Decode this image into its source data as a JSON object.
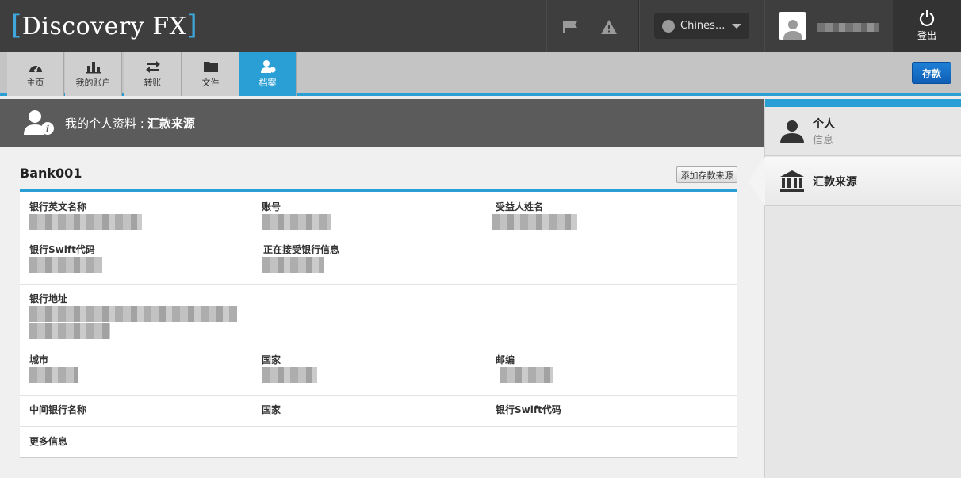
{
  "header": {
    "logo_open": "[",
    "logo_text": "Discovery FX",
    "logo_close": "]",
    "language": "Chines...",
    "logout_label": "登出"
  },
  "nav": {
    "tabs": [
      {
        "label": "主页",
        "icon": "dashboard-icon"
      },
      {
        "label": "我的账户",
        "icon": "bar-chart-icon"
      },
      {
        "label": "转账",
        "icon": "transfer-arrows-icon"
      },
      {
        "label": "文件",
        "icon": "folder-icon"
      },
      {
        "label": "档案",
        "icon": "profile-icon",
        "active": true
      }
    ],
    "deposit_label": "存款"
  },
  "page": {
    "title_prefix": "我的个人资料 :",
    "title_bold": "汇款来源"
  },
  "bank": {
    "name": "Bank001",
    "add_source_label": "添加存款来源",
    "fields": {
      "bank_en_name": "银行英文名称",
      "account_no": "账号",
      "beneficiary_name": "受益人姓名",
      "swift": "银行Swift代码",
      "receiving_bank": "正在接受银行信息",
      "address": "银行地址",
      "city": "城市",
      "country": "国家",
      "postcode": "邮编",
      "intermediary_bank": "中间银行名称",
      "intermediary_country": "国家",
      "intermediary_swift": "银行Swift代码",
      "more_info": "更多信息"
    }
  },
  "sidebar": {
    "items": [
      {
        "title": "个人",
        "subtitle": "信息"
      },
      {
        "title": "汇款来源",
        "subtitle": ""
      }
    ]
  },
  "colors": {
    "accent": "#2a9fd6",
    "header_bg": "#3e3e3e",
    "deposit_button": "#1e7fd6"
  }
}
